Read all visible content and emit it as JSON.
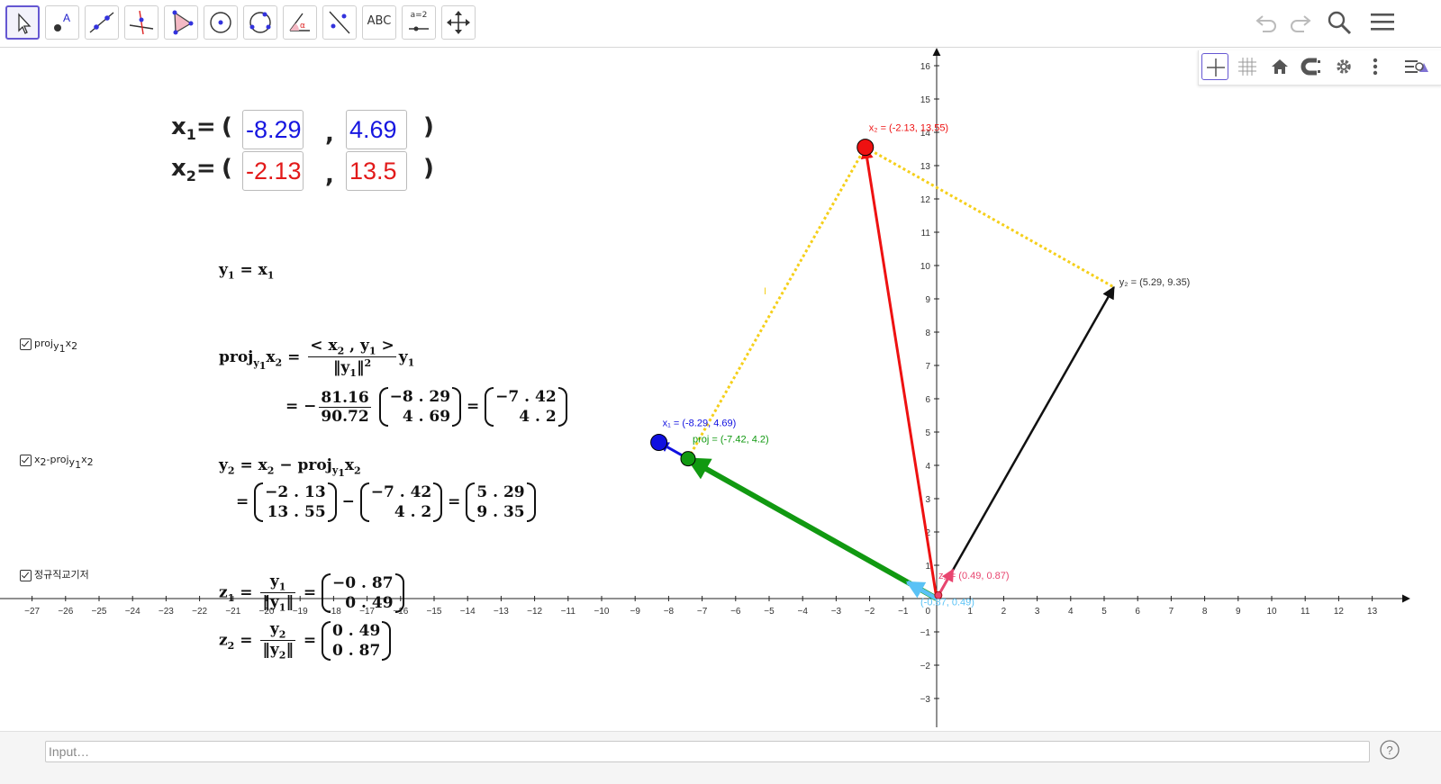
{
  "toolbar": {
    "tools": [
      {
        "name": "move-tool",
        "text": ""
      },
      {
        "name": "point-tool",
        "text": ""
      },
      {
        "name": "line-tool",
        "text": ""
      },
      {
        "name": "perpendicular-line-tool",
        "text": ""
      },
      {
        "name": "polygon-tool",
        "text": ""
      },
      {
        "name": "circle-center-point-tool",
        "text": ""
      },
      {
        "name": "circle-three-points-tool",
        "text": ""
      },
      {
        "name": "angle-tool",
        "text": ""
      },
      {
        "name": "reflect-tool",
        "text": ""
      },
      {
        "name": "text-tool",
        "text": "ABC"
      },
      {
        "name": "slider-tool",
        "text": "a=2"
      },
      {
        "name": "move-graphics-view-tool",
        "text": ""
      }
    ]
  },
  "graphics_bar": {
    "buttons": [
      "axes-toggle",
      "grid-toggle",
      "standard-view",
      "point-capturing",
      "settings",
      "more",
      "style-bar-toggle"
    ]
  },
  "inputs": {
    "x1_label": "x",
    "x1_sub": "1",
    "x2_label": "x",
    "x2_sub": "2",
    "eq_sign": "=",
    "open": "(",
    "comma": ",",
    "close": ")",
    "x1_a": "-8.29",
    "x1_b": "4.69",
    "x2_a": "-2.13",
    "x2_b": "13.5"
  },
  "checkboxes": {
    "proj_label_pre": "proj",
    "proj_label_y": "y",
    "proj_label_sub1": "1",
    "proj_label_x": "x",
    "proj_label_sub2": "2",
    "diff_label_pre": "x",
    "diff_label_sub2": "2",
    "diff_label_mid": "-proj",
    "ortho_label": "정규직교기저"
  },
  "equations": {
    "y1": "y",
    "y1_sub": "1",
    "x1": "x",
    "proj": "proj",
    "coef_num": "81.16",
    "coef_den": "90.72",
    "m_x1": [
      "−8 . 29",
      "4 . 69"
    ],
    "m_proj": [
      "−7 . 42",
      "4 . 2"
    ],
    "m_x2": [
      "−2 . 13",
      "13 . 55"
    ],
    "m_y2": [
      "5 . 29",
      "9 . 35"
    ],
    "m_z1": [
      "−0 . 87",
      "0 . 49"
    ],
    "m_z2": [
      "0 . 49",
      "0 . 87"
    ],
    "z": "z"
  },
  "plot": {
    "x_ticks": [
      -27,
      -26,
      -25,
      -24,
      -23,
      -22,
      -21,
      -20,
      -19,
      -18,
      -17,
      -16,
      -15,
      -14,
      -13,
      -12,
      -11,
      -10,
      -9,
      -8,
      -7,
      -6,
      -5,
      -4,
      -3,
      -2,
      -1,
      1,
      2,
      3,
      4,
      5,
      6,
      7,
      8,
      9,
      10,
      11,
      12,
      13
    ],
    "y_ticks": [
      -3,
      -2,
      -1,
      1,
      2,
      3,
      4,
      5,
      6,
      7,
      8,
      9,
      10,
      11,
      12,
      13,
      14,
      15,
      16
    ],
    "origin_label": "0",
    "points": {
      "x1": {
        "x": -8.29,
        "y": 4.69,
        "color": "#1010e0"
      },
      "x2": {
        "x": -2.13,
        "y": 13.55,
        "color": "#ee1111"
      },
      "y2": {
        "x": 5.29,
        "y": 9.35,
        "color": "#111111"
      },
      "proj": {
        "x": -7.42,
        "y": 4.2,
        "color": "#119911"
      },
      "z1": {
        "x": -0.87,
        "y": 0.49,
        "color": "#5ac2f5"
      },
      "z2": {
        "x": 0.49,
        "y": 0.87,
        "color": "#e8456f"
      }
    },
    "labels": {
      "x1": "x₁ = (-8.29, 4.69)",
      "x2": "x₂ = (-2.13, 13.55)",
      "y2": "y₂ = (5.29, 9.35)",
      "proj": "proj = (-7.42, 4.2)",
      "z2": "z₂ = (0.49, 0.87)",
      "z1": "(-0.87, 0.49)"
    },
    "small_mark": "I"
  },
  "input_bar": {
    "placeholder": "Input…",
    "help": "?"
  }
}
